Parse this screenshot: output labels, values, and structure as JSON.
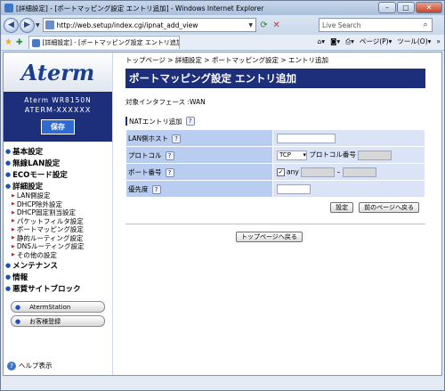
{
  "window": {
    "title": "[詳細設定] - [ポートマッピング設定 エントリ追加] - Windows Internet Explorer"
  },
  "address": {
    "url": "http://web.setup/index.cgi/ipnat_add_view"
  },
  "search": {
    "placeholder": "Live Search"
  },
  "tab": {
    "label": "[詳細設定] - [ポートマッピング設定 エントリ追加]"
  },
  "toolbar": {
    "page": "ページ(P)",
    "tools": "ツール(O)"
  },
  "sidebar": {
    "logo": "Aterm",
    "model": "Aterm WR8150N",
    "device": "ATERM-XXXXXX",
    "save": "保存",
    "menu": [
      {
        "label": "基本設定"
      },
      {
        "label": "無線LAN設定"
      },
      {
        "label": "ECOモード設定"
      },
      {
        "label": "詳細設定"
      }
    ],
    "submenu": [
      "LAN側設定",
      "DHCP除外設定",
      "DHCP固定割当設定",
      "パケットフィルタ設定",
      "ポートマッピング設定",
      "静的ルーティング設定",
      "DNSルーティング設定",
      "その他の設定"
    ],
    "menu2": [
      {
        "label": "メンテナンス"
      },
      {
        "label": "情報"
      },
      {
        "label": "悪質サイトブロック"
      }
    ],
    "buttons": [
      "AtermStation",
      "お客様登録"
    ],
    "help": "ヘルプ表示"
  },
  "main": {
    "breadcrumb": "トップページ > 詳細設定 > ポートマッピング設定 > エントリ追加",
    "title": "ポートマッピング設定 エントリ追加",
    "interface": "対象インタフェース :WAN",
    "section": "NATエントリ追加",
    "fields": {
      "lan_host": "LAN側ホスト",
      "protocol": "プロトコル",
      "protocol_value": "TCP",
      "protocol_number": "プロトコル番号",
      "port": "ポート番号",
      "any": "any",
      "dash": "–",
      "priority": "優先度"
    },
    "buttons": {
      "set": "設定",
      "back": "前のページへ戻る",
      "top": "トップページへ戻る"
    }
  }
}
